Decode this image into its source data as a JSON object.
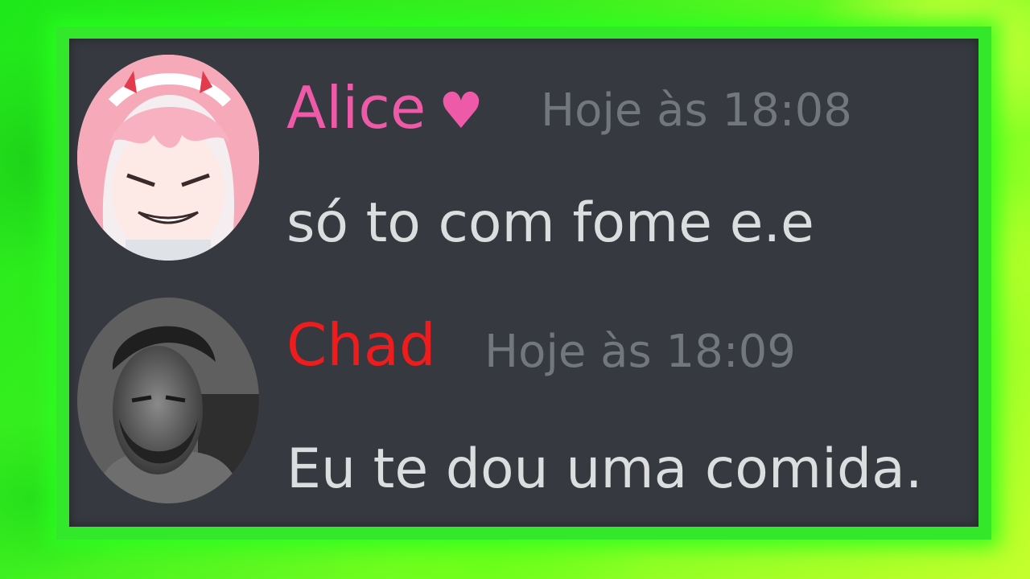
{
  "theme": {
    "panel_bg": "#36393f",
    "frame_glow": "#33e82a",
    "timestamp_color": "#72767d",
    "message_color": "#dcddde"
  },
  "messages": [
    {
      "username": "Alice",
      "username_icon": "heart-icon",
      "username_icon_glyph": "♥",
      "username_color": "#ef5aa8",
      "timestamp": "Hoje às 18:08",
      "text": "só to com fome e.e",
      "avatar": "anime-girl-pink-hair-avatar"
    },
    {
      "username": "Chad",
      "username_color": "#ee1c1c",
      "timestamp": "Hoje às 18:09",
      "text": "Eu te dou uma comida.",
      "avatar": "bearded-man-grayscale-avatar"
    }
  ]
}
